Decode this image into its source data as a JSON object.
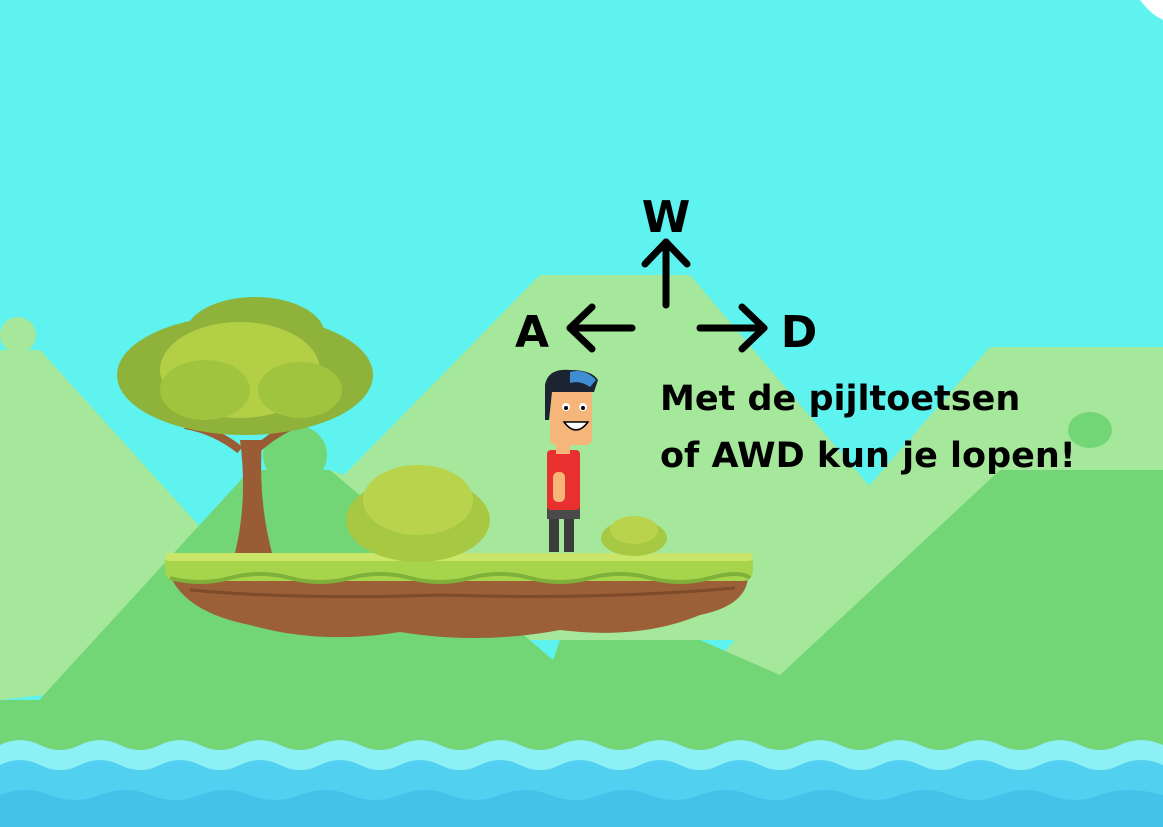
{
  "controls": {
    "up_key": "W",
    "left_key": "A",
    "right_key": "D",
    "hint_line_1": "Met de pijltoetsen",
    "hint_line_2": "of AWD kun je lopen!"
  },
  "icons": {
    "up": "arrow-up-icon",
    "left": "arrow-left-icon",
    "right": "arrow-right-icon"
  },
  "colors": {
    "sky": "#5ef3ef",
    "hill_light": "#a5e79b",
    "hill_dark": "#72d576",
    "grass": "#a6d44b",
    "dirt": "#9b6038",
    "water": "#52d0f0",
    "shirt": "#e8312f",
    "text": "#000000"
  }
}
